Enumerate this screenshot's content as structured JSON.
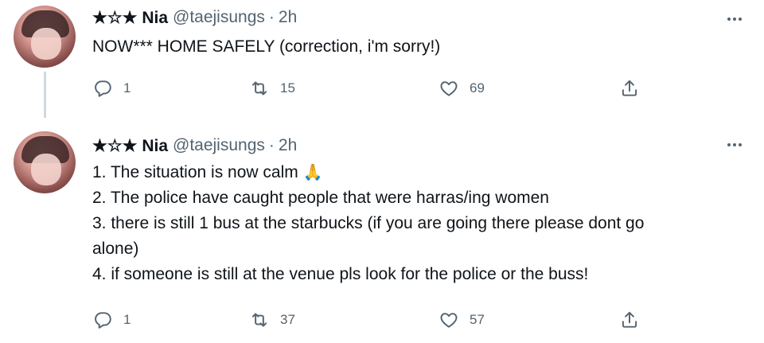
{
  "tweets": [
    {
      "author": {
        "name": "★☆★ Nia",
        "handle": "@taejisungs",
        "separator": "·",
        "time": "2h"
      },
      "text": [
        "NOW*** HOME SAFELY (correction, i'm sorry!)"
      ],
      "stats": {
        "replies": "1",
        "retweets": "15",
        "likes": "69"
      }
    },
    {
      "author": {
        "name": "★☆★ Nia",
        "handle": "@taejisungs",
        "separator": "·",
        "time": "2h"
      },
      "text": [
        "1. The situation is now calm",
        "2. The police have caught people that were harras/ing women",
        "3. there is still 1 bus at the starbucks (if you are going there please dont go",
        "alone)",
        "4. if someone is still at the venue pls look for the police or the buss!"
      ],
      "emoji": "🙏",
      "stats": {
        "replies": "1",
        "retweets": "37",
        "likes": "57"
      }
    }
  ],
  "icons": {
    "reply": "reply-icon",
    "retweet": "retweet-icon",
    "like": "heart-icon",
    "share": "share-icon",
    "more": "more-options-icon"
  },
  "colors": {
    "text": "#0f1419",
    "secondary": "#536471",
    "thread_line": "#cfd9de"
  }
}
